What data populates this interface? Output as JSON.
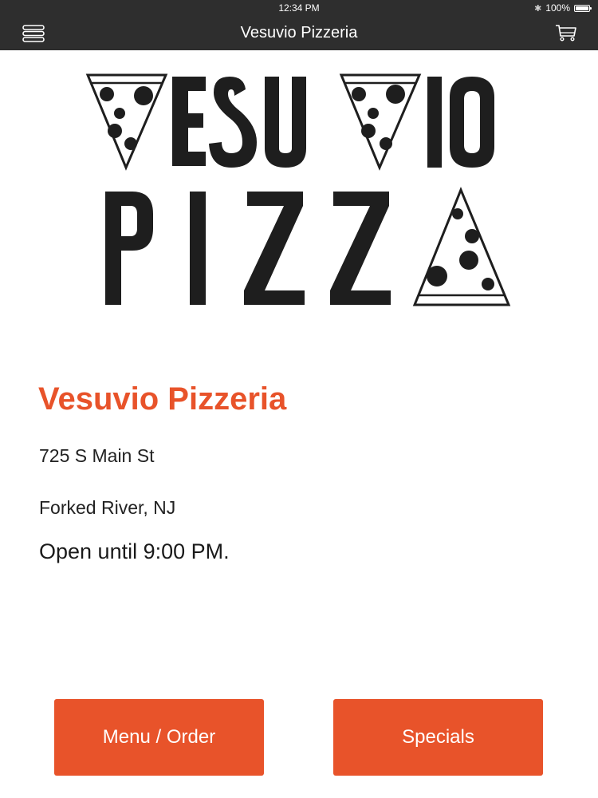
{
  "status_bar": {
    "time": "12:34 PM",
    "battery": "100%",
    "icons": [
      "bluetooth-icon",
      "battery-icon"
    ]
  },
  "nav": {
    "title": "Vesuvio Pizzeria",
    "left_icon": "menu-icon",
    "right_icon": "cart-icon"
  },
  "logo": {
    "line1": "VESUVIO",
    "line2": "PIZZA"
  },
  "restaurant": {
    "name": "Vesuvio Pizzeria",
    "address_line1": "725 S Main St",
    "address_line2": "Forked River, NJ",
    "hours": "Open until 9:00 PM."
  },
  "buttons": {
    "menu_order": "Menu / Order",
    "specials": "Specials"
  },
  "colors": {
    "accent": "#e8532a",
    "bar": "#2e2e2e"
  }
}
